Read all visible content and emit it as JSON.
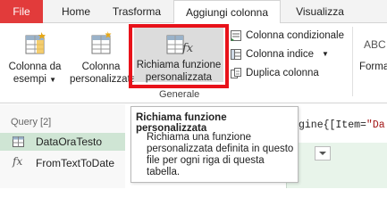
{
  "tabs": {
    "file": "File",
    "home": "Home",
    "transform": "Trasforma",
    "add_column": "Aggiungi colonna",
    "view": "Visualizza"
  },
  "ribbon": {
    "col_from_examples": [
      "Colonna da",
      "esempi"
    ],
    "custom_column": [
      "Colonna",
      "personalizzata"
    ],
    "invoke_custom_function": [
      "Richiama funzione",
      "personalizzata"
    ],
    "conditional_column": "Colonna condizionale",
    "index_column": "Colonna indice",
    "duplicate_column": "Duplica colonna",
    "format_partial": "Forma",
    "general_group": "Generale"
  },
  "queries": {
    "header": "Query [2]",
    "items": [
      {
        "label": "DataOraTesto",
        "icon": "table-icon",
        "selected": true
      },
      {
        "label": "FromTextToDate",
        "icon": "function-icon",
        "selected": false
      }
    ]
  },
  "formula": {
    "prefix": "gine{[Item=",
    "string_fragment": "\"Da"
  },
  "tooltip": {
    "title": "Richiama funzione personalizzata",
    "body": "Richiama una funzione personalizzata definita in questo file per ogni riga di questa tabella."
  },
  "colors": {
    "file_tab": "#e23b3b",
    "selected_query": "#cfe5d4",
    "highlight": "#e8121a"
  }
}
